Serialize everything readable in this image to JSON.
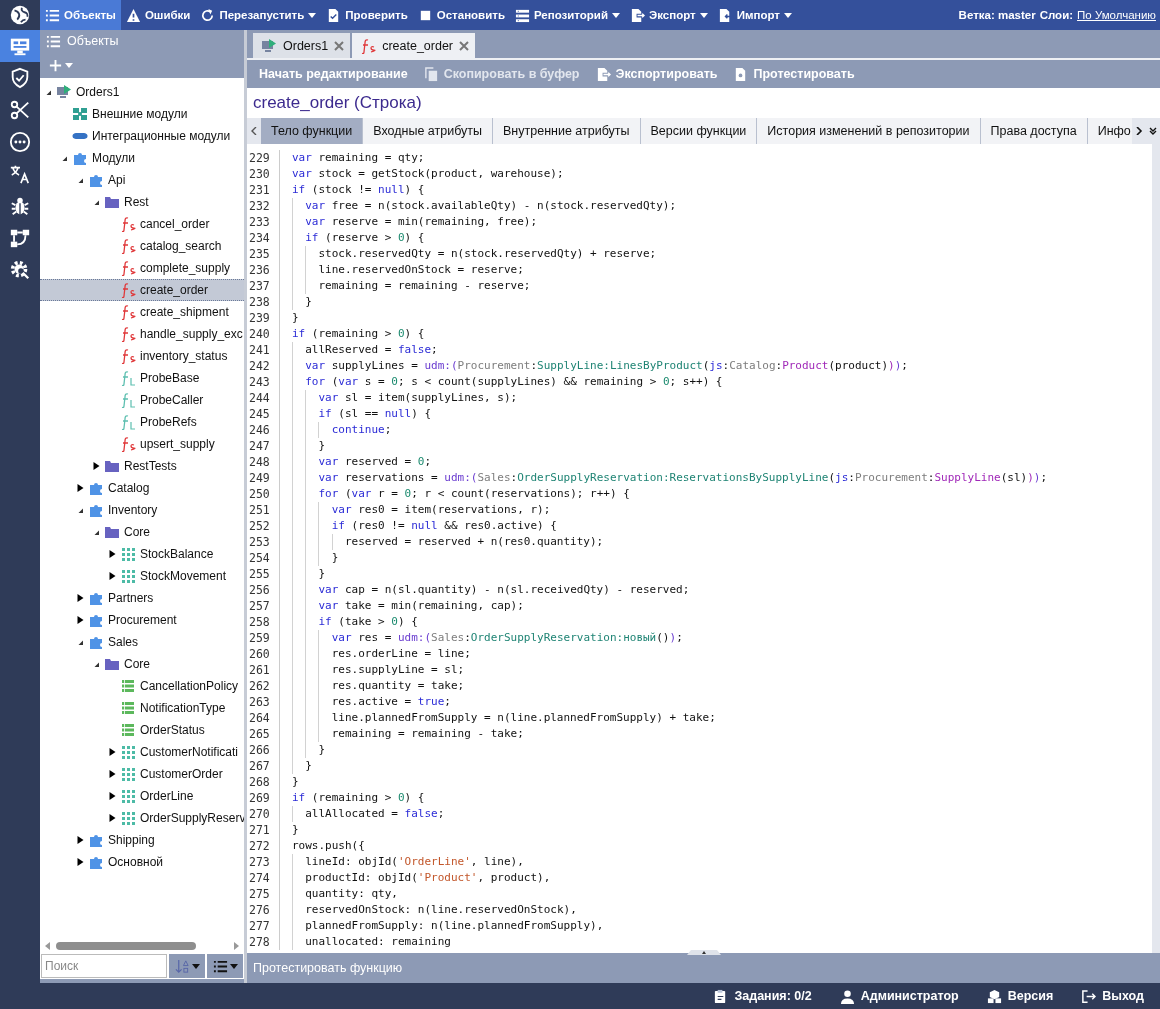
{
  "rail": [
    {
      "kind": "globe",
      "selected": false
    },
    {
      "kind": "monitor",
      "selected": true
    },
    {
      "kind": "shield",
      "selected": false
    },
    {
      "kind": "scissors",
      "selected": false
    },
    {
      "kind": "dots",
      "selected": false
    },
    {
      "kind": "translate",
      "selected": false
    },
    {
      "kind": "bug",
      "selected": false
    },
    {
      "kind": "flow",
      "selected": false
    },
    {
      "kind": "gear-search",
      "selected": false
    }
  ],
  "toolbar": {
    "items": [
      {
        "label": "Объекты",
        "kind": "list",
        "dropdown": false,
        "selected": true
      },
      {
        "label": "Ошибки",
        "kind": "warning",
        "dropdown": false,
        "selected": false
      },
      {
        "label": "Перезапустить",
        "kind": "refresh",
        "dropdown": true,
        "selected": false
      },
      {
        "label": "Проверить",
        "kind": "check-doc",
        "dropdown": false,
        "selected": false
      },
      {
        "label": "Остановить",
        "kind": "stop",
        "dropdown": false,
        "selected": false
      },
      {
        "label": "Репозиторий",
        "kind": "repo",
        "dropdown": true,
        "selected": false
      },
      {
        "label": "Экспорт",
        "kind": "export",
        "dropdown": true,
        "selected": false
      },
      {
        "label": "Импорт",
        "kind": "import",
        "dropdown": true,
        "selected": false
      }
    ],
    "branch": "Ветка: master",
    "layers_label": "Слои:",
    "layers_link": "По Умолчанию"
  },
  "objects_panel": {
    "title": "Объекты",
    "tree": [
      {
        "label": "Orders1",
        "kind": "project",
        "expanded": true,
        "selected": false,
        "children": [
          {
            "label": "Внешние модули",
            "kind": "ext-modules",
            "selected": false
          },
          {
            "label": "Интеграционные модули",
            "kind": "int-modules",
            "selected": false
          },
          {
            "label": "Модули",
            "kind": "module",
            "expanded": true,
            "selected": false,
            "children": [
              {
                "label": "Api",
                "kind": "module",
                "expanded": true,
                "selected": false,
                "children": [
                  {
                    "label": "Rest",
                    "kind": "folder",
                    "expanded": true,
                    "selected": false,
                    "children": [
                      {
                        "label": "cancel_order",
                        "kind": "function",
                        "selected": false
                      },
                      {
                        "label": "catalog_search",
                        "kind": "function",
                        "selected": false
                      },
                      {
                        "label": "complete_supply",
                        "kind": "function",
                        "selected": false
                      },
                      {
                        "label": "create_order",
                        "kind": "function",
                        "selected": true
                      },
                      {
                        "label": "create_shipment",
                        "kind": "function",
                        "selected": false
                      },
                      {
                        "label": "handle_supply_exc",
                        "kind": "function",
                        "selected": false
                      },
                      {
                        "label": "inventory_status",
                        "kind": "function",
                        "selected": false
                      },
                      {
                        "label": "ProbeBase",
                        "kind": "probe",
                        "selected": false
                      },
                      {
                        "label": "ProbeCaller",
                        "kind": "probe",
                        "selected": false
                      },
                      {
                        "label": "ProbeRefs",
                        "kind": "probe",
                        "selected": false
                      },
                      {
                        "label": "upsert_supply",
                        "kind": "function",
                        "selected": false
                      }
                    ]
                  },
                  {
                    "label": "RestTests",
                    "kind": "folder",
                    "expanded": false,
                    "selected": false
                  }
                ]
              },
              {
                "label": "Catalog",
                "kind": "module",
                "expanded": false,
                "selected": false
              },
              {
                "label": "Inventory",
                "kind": "module",
                "expanded": true,
                "selected": false,
                "children": [
                  {
                    "label": "Core",
                    "kind": "folder",
                    "expanded": true,
                    "selected": false,
                    "children": [
                      {
                        "label": "StockBalance",
                        "kind": "table",
                        "expanded": false,
                        "selected": false
                      },
                      {
                        "label": "StockMovement",
                        "kind": "table",
                        "expanded": false,
                        "selected": false
                      }
                    ]
                  }
                ]
              },
              {
                "label": "Partners",
                "kind": "module",
                "expanded": false,
                "selected": false
              },
              {
                "label": "Procurement",
                "kind": "module",
                "expanded": false,
                "selected": false
              },
              {
                "label": "Sales",
                "kind": "module",
                "expanded": true,
                "selected": false,
                "children": [
                  {
                    "label": "Core",
                    "kind": "folder",
                    "expanded": true,
                    "selected": false,
                    "children": [
                      {
                        "label": "CancellationPolicy",
                        "kind": "dictionary",
                        "selected": false
                      },
                      {
                        "label": "NotificationType",
                        "kind": "dictionary",
                        "selected": false
                      },
                      {
                        "label": "OrderStatus",
                        "kind": "dictionary",
                        "selected": false
                      },
                      {
                        "label": "CustomerNotificati",
                        "kind": "table",
                        "expanded": false,
                        "selected": false
                      },
                      {
                        "label": "CustomerOrder",
                        "kind": "table",
                        "expanded": false,
                        "selected": false
                      },
                      {
                        "label": "OrderLine",
                        "kind": "table",
                        "expanded": false,
                        "selected": false
                      },
                      {
                        "label": "OrderSupplyReserv",
                        "kind": "table",
                        "expanded": false,
                        "selected": false
                      }
                    ]
                  }
                ]
              },
              {
                "label": "Shipping",
                "kind": "module",
                "expanded": false,
                "selected": false
              },
              {
                "label": "Основной",
                "kind": "module",
                "expanded": false,
                "selected": false
              }
            ]
          }
        ]
      }
    ],
    "search": {
      "placeholder": "Поиск"
    }
  },
  "doc_tabs": [
    {
      "label": "Orders1",
      "kind": "project",
      "selected": false
    },
    {
      "label": "create_order",
      "kind": "function",
      "selected": true
    }
  ],
  "actions": [
    {
      "label": "Начать редактирование",
      "kind": "plain",
      "disabled": false
    },
    {
      "label": "Скопировать в буфер",
      "kind": "copy",
      "disabled": true
    },
    {
      "label": "Экспортировать",
      "kind": "export",
      "disabled": false
    },
    {
      "label": "Протестировать",
      "kind": "test",
      "disabled": false
    }
  ],
  "title": "create_order (Строка)",
  "function_tabs": [
    {
      "label": "Тело функции",
      "selected": true
    },
    {
      "label": "Входные атрибуты",
      "selected": false
    },
    {
      "label": "Внутренние атрибуты",
      "selected": false
    },
    {
      "label": "Версии функции",
      "selected": false
    },
    {
      "label": "История изменений в репозитории",
      "selected": false
    },
    {
      "label": "Права доступа",
      "selected": false
    },
    {
      "label": "Инфо",
      "selected": false
    }
  ],
  "code": [
    {
      "number": "229",
      "tokens": [
        {
          "kind": "kw",
          "text": "var"
        },
        " remaining = qty;"
      ]
    },
    {
      "number": "230",
      "tokens": [
        {
          "kind": "kw",
          "text": "var"
        },
        " stock = getStock(product, warehouse);"
      ]
    },
    {
      "number": "231",
      "tokens": [
        {
          "kind": "kw",
          "text": "if"
        },
        " (stock != ",
        {
          "kind": "kw",
          "text": "null"
        },
        ") {"
      ]
    },
    {
      "number": "232",
      "tokens": [
        {
          "kind": "kw",
          "text": "  var"
        },
        " free = n(stock.availableQty) - n(stock.reservedQty);"
      ]
    },
    {
      "number": "233",
      "tokens": [
        {
          "kind": "kw",
          "text": "  var"
        },
        " reserve = min(remaining, free);"
      ]
    },
    {
      "number": "234",
      "tokens": [
        {
          "kind": "kw",
          "text": "  if"
        },
        " (reserve > ",
        {
          "kind": "num",
          "text": "0"
        },
        ") {"
      ]
    },
    {
      "number": "235",
      "tokens": [
        "    stock.reservedQty = n(stock.reservedQty) + reserve;"
      ]
    },
    {
      "number": "236",
      "tokens": [
        "    line.reservedOnStock = reserve;"
      ]
    },
    {
      "number": "237",
      "tokens": [
        "    remaining = remaining - reserve;"
      ]
    },
    {
      "number": "238",
      "tokens": [
        "  }"
      ]
    },
    {
      "number": "239",
      "tokens": [
        "}"
      ]
    },
    {
      "number": "240",
      "tokens": [
        {
          "kind": "kw",
          "text": "if"
        },
        " (remaining > ",
        {
          "kind": "num",
          "text": "0"
        },
        ") {"
      ]
    },
    {
      "number": "241",
      "tokens": [
        "  allReserved = ",
        {
          "kind": "kw",
          "text": "false"
        },
        ";"
      ]
    },
    {
      "number": "242",
      "tokens": [
        {
          "kind": "kw",
          "text": "  var"
        },
        " supplyLines = ",
        {
          "kind": "udm",
          "text": "udm:("
        },
        {
          "kind": "ns",
          "text": "Procurement"
        },
        ":",
        {
          "kind": "cls",
          "text": "SupplyLine:LinesByProduct"
        },
        "(",
        {
          "kind": "kw",
          "text": "js"
        },
        ":",
        {
          "kind": "ns",
          "text": "Catalog"
        },
        ":",
        {
          "kind": "fn",
          "text": "Product"
        },
        "(product)",
        {
          "kind": "fn",
          "text": ")"
        },
        {
          "kind": "udm",
          "text": ")"
        },
        ";"
      ]
    },
    {
      "number": "243",
      "tokens": [
        {
          "kind": "kw",
          "text": "  for"
        },
        " (",
        {
          "kind": "kw",
          "text": "var"
        },
        " s = ",
        {
          "kind": "num",
          "text": "0"
        },
        "; s < count(supplyLines) && remaining > ",
        {
          "kind": "num",
          "text": "0"
        },
        "; s++) {"
      ]
    },
    {
      "number": "244",
      "tokens": [
        {
          "kind": "kw",
          "text": "    var"
        },
        " sl = item(supplyLines, s);"
      ]
    },
    {
      "number": "245",
      "tokens": [
        {
          "kind": "kw",
          "text": "    if"
        },
        " (sl == ",
        {
          "kind": "kw",
          "text": "null"
        },
        ") {"
      ]
    },
    {
      "number": "246",
      "tokens": [
        {
          "kind": "kw",
          "text": "      continue"
        },
        ";"
      ]
    },
    {
      "number": "247",
      "tokens": [
        "    }"
      ]
    },
    {
      "number": "248",
      "tokens": [
        {
          "kind": "kw",
          "text": "    var"
        },
        " reserved = ",
        {
          "kind": "num",
          "text": "0"
        },
        ";"
      ]
    },
    {
      "number": "249",
      "tokens": [
        {
          "kind": "kw",
          "text": "    var"
        },
        " reservations = ",
        {
          "kind": "udm",
          "text": "udm:("
        },
        {
          "kind": "ns",
          "text": "Sales"
        },
        ":",
        {
          "kind": "cls",
          "text": "OrderSupplyReservation:ReservationsBySupplyLine"
        },
        "(",
        {
          "kind": "kw",
          "text": "js"
        },
        ":",
        {
          "kind": "ns",
          "text": "Procurement"
        },
        ":",
        {
          "kind": "fn",
          "text": "SupplyLine"
        },
        "(sl)",
        {
          "kind": "fn",
          "text": ")"
        },
        {
          "kind": "udm",
          "text": ")"
        },
        ";"
      ]
    },
    {
      "number": "250",
      "tokens": [
        {
          "kind": "kw",
          "text": "    for"
        },
        " (",
        {
          "kind": "kw",
          "text": "var"
        },
        " r = ",
        {
          "kind": "num",
          "text": "0"
        },
        "; r < count(reservations); r++) {"
      ]
    },
    {
      "number": "251",
      "tokens": [
        {
          "kind": "kw",
          "text": "      var"
        },
        " res0 = item(reservations, r);"
      ]
    },
    {
      "number": "252",
      "tokens": [
        {
          "kind": "kw",
          "text": "      if"
        },
        " (res0 != ",
        {
          "kind": "kw",
          "text": "null"
        },
        " && res0.active) {"
      ]
    },
    {
      "number": "253",
      "tokens": [
        "        reserved = reserved + n(res0.quantity);"
      ]
    },
    {
      "number": "254",
      "tokens": [
        "      }"
      ]
    },
    {
      "number": "255",
      "tokens": [
        "    }"
      ]
    },
    {
      "number": "256",
      "tokens": [
        {
          "kind": "kw",
          "text": "    var"
        },
        " cap = n(sl.quantity) - n(sl.receivedQty) - reserved;"
      ]
    },
    {
      "number": "257",
      "tokens": [
        {
          "kind": "kw",
          "text": "    var"
        },
        " take = min(remaining, cap);"
      ]
    },
    {
      "number": "258",
      "tokens": [
        {
          "kind": "kw",
          "text": "    if"
        },
        " (take > ",
        {
          "kind": "num",
          "text": "0"
        },
        ") {"
      ]
    },
    {
      "number": "259",
      "tokens": [
        {
          "kind": "kw",
          "text": "      var"
        },
        " res = ",
        {
          "kind": "udm",
          "text": "udm:("
        },
        {
          "kind": "ns",
          "text": "Sales"
        },
        ":",
        {
          "kind": "cls",
          "text": "OrderSupplyReservation:новый"
        },
        "()",
        {
          "kind": "udm",
          "text": ")"
        },
        ";"
      ]
    },
    {
      "number": "260",
      "tokens": [
        "      res.orderLine = line;"
      ]
    },
    {
      "number": "261",
      "tokens": [
        "      res.supplyLine = sl;"
      ]
    },
    {
      "number": "262",
      "tokens": [
        "      res.quantity = take;"
      ]
    },
    {
      "number": "263",
      "tokens": [
        "      res.active = ",
        {
          "kind": "kw",
          "text": "true"
        },
        ";"
      ]
    },
    {
      "number": "264",
      "tokens": [
        "      line.plannedFromSupply = n(line.plannedFromSupply) + take;"
      ]
    },
    {
      "number": "265",
      "tokens": [
        "      remaining = remaining - take;"
      ]
    },
    {
      "number": "266",
      "tokens": [
        "    }"
      ]
    },
    {
      "number": "267",
      "tokens": [
        "  }"
      ]
    },
    {
      "number": "268",
      "tokens": [
        "}"
      ]
    },
    {
      "number": "269",
      "tokens": [
        {
          "kind": "kw",
          "text": "if"
        },
        " (remaining > ",
        {
          "kind": "num",
          "text": "0"
        },
        ") {"
      ]
    },
    {
      "number": "270",
      "tokens": [
        "  allAllocated = ",
        {
          "kind": "kw",
          "text": "false"
        },
        ";"
      ]
    },
    {
      "number": "271",
      "tokens": [
        "}"
      ]
    },
    {
      "number": "272",
      "tokens": [
        "rows.push({"
      ]
    },
    {
      "number": "273",
      "tokens": [
        "  lineId: objId(",
        {
          "kind": "str",
          "text": "'OrderLine'"
        },
        ", line),"
      ]
    },
    {
      "number": "274",
      "tokens": [
        "  productId: objId(",
        {
          "kind": "str",
          "text": "'Product'"
        },
        ", product),"
      ]
    },
    {
      "number": "275",
      "tokens": [
        "  quantity: qty,"
      ]
    },
    {
      "number": "276",
      "tokens": [
        "  reservedOnStock: n(line.reservedOnStock),"
      ]
    },
    {
      "number": "277",
      "tokens": [
        "  plannedFromSupply: n(line.plannedFromSupply),"
      ]
    },
    {
      "number": "278",
      "tokens": [
        "  unallocated: remaining"
      ]
    }
  ],
  "test_panel": {
    "label": "Протестировать функцию"
  },
  "status_bar": [
    {
      "label": "Задания: 0/2",
      "kind": "clipboard"
    },
    {
      "label": "Администратор",
      "kind": "person"
    },
    {
      "label": "Версия",
      "kind": "boxes"
    },
    {
      "label": "Выход",
      "kind": "exit"
    }
  ]
}
